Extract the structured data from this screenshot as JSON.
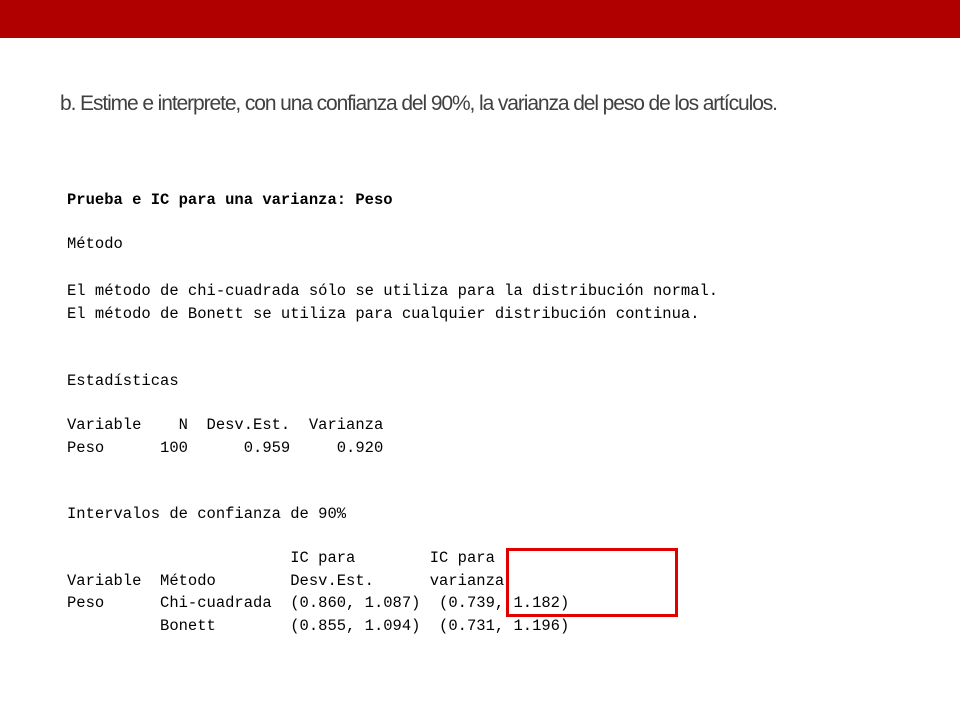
{
  "slide": {
    "title": "b. Estime e interprete, con una confianza del 90%, la varianza del peso de los artículos."
  },
  "output": {
    "header": "Prueba e IC para una varianza: Peso",
    "method_heading": "Método",
    "method_lines": [
      "El método de chi-cuadrada sólo se utiliza para la distribución normal.",
      "El método de Bonett se utiliza para cualquier distribución continua."
    ],
    "stats_heading": "Estadísticas",
    "stats_table": {
      "header": "Variable    N  Desv.Est.  Varianza",
      "rows": [
        "Peso      100      0.959     0.920"
      ]
    },
    "ci_heading": "Intervalos de confianza de 90%",
    "ci_table": {
      "header_line1": "                        IC para        IC para",
      "header_line2": "Variable  Método        Desv.Est.      varianza",
      "rows": [
        "Peso      Chi-cuadrada  (0.860, 1.087)  (0.739, 1.182)",
        "          Bonett        (0.855, 1.094)  (0.731, 1.196)"
      ]
    }
  },
  "colors": {
    "top_bar": "#b00000",
    "highlight": "#e00000",
    "title_text": "#404040"
  }
}
